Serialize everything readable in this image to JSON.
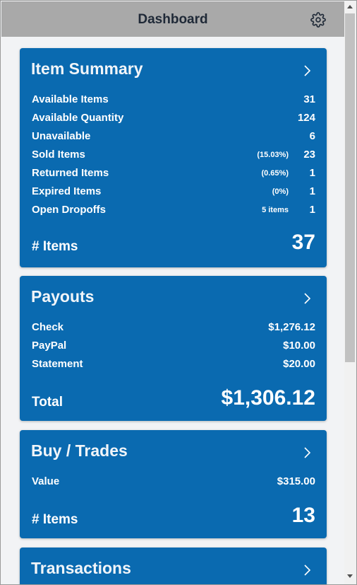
{
  "header": {
    "title": "Dashboard",
    "settings_icon": "gear-icon"
  },
  "item_summary": {
    "title": "Item Summary",
    "rows": [
      {
        "label": "Available Items",
        "note": "",
        "value": "31"
      },
      {
        "label": "Available Quantity",
        "note": "",
        "value": "124"
      },
      {
        "label": "Unavailable",
        "note": "",
        "value": "6"
      },
      {
        "label": "Sold Items",
        "note": "(15.03%)",
        "value": "23"
      },
      {
        "label": "Returned Items",
        "note": "(0.65%)",
        "value": "1"
      },
      {
        "label": "Expired Items",
        "note": "(0%)",
        "value": "1"
      },
      {
        "label": "Open Dropoffs",
        "note": "5 items",
        "value": "1"
      }
    ],
    "total_label": "# Items",
    "total_value": "37"
  },
  "payouts": {
    "title": "Payouts",
    "rows": [
      {
        "label": "Check",
        "value": "$1,276.12"
      },
      {
        "label": "PayPal",
        "value": "$10.00"
      },
      {
        "label": "Statement",
        "value": "$20.00"
      }
    ],
    "total_label": "Total",
    "total_value": "$1,306.12"
  },
  "buy_trades": {
    "title": "Buy / Trades",
    "rows": [
      {
        "label": "Value",
        "value": "$315.00"
      }
    ],
    "total_label": "# Items",
    "total_value": "13"
  },
  "transactions": {
    "title": "Transactions"
  },
  "colors": {
    "card": "#0a6ab0",
    "header": "#a9a9a9",
    "background": "#f2f3f5"
  }
}
